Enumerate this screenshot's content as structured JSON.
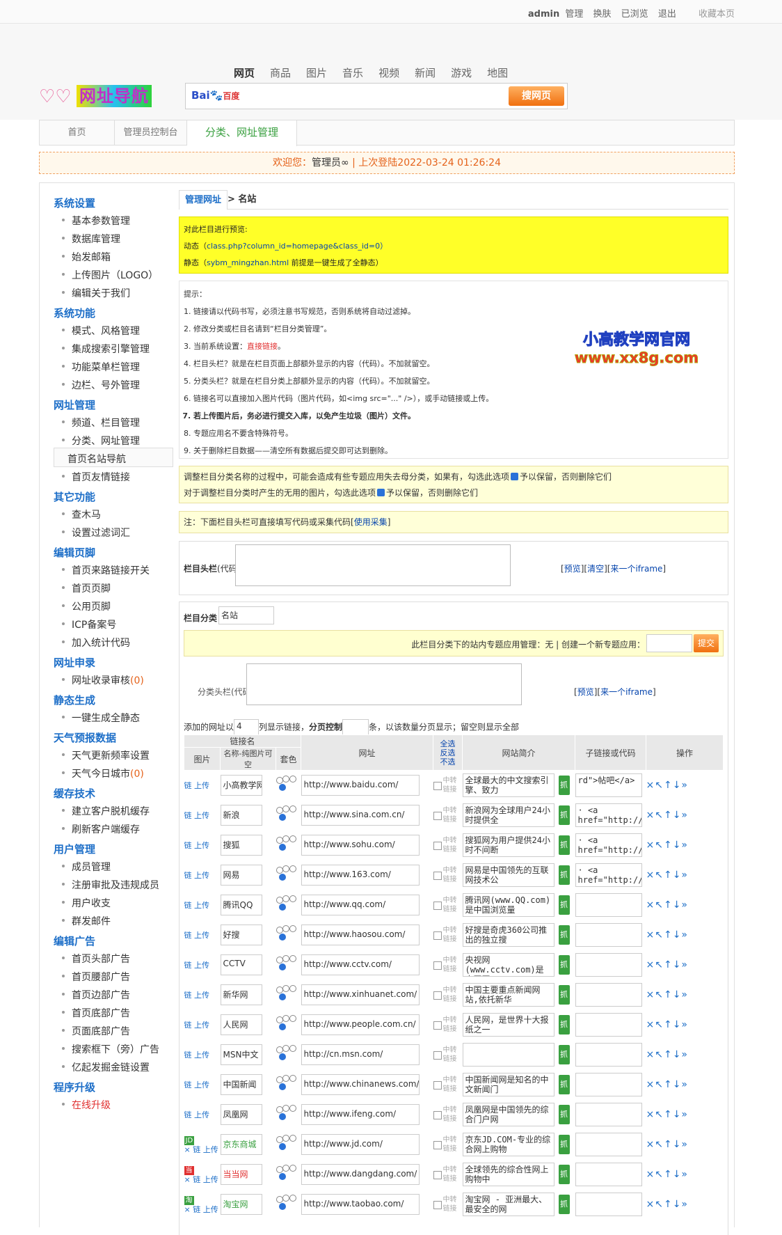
{
  "topbar": {
    "user": "admin",
    "manage": "管理",
    "skin": "换肤",
    "viewed": "已浏览",
    "logout": "退出",
    "bookmark": "收藏本页"
  },
  "logo": {
    "text": "网址导航"
  },
  "search": {
    "tabs": [
      "网页",
      "商品",
      "图片",
      "音乐",
      "视频",
      "新闻",
      "游戏",
      "地图"
    ],
    "engine_a": "Bai",
    "engine_b": "百度",
    "button": "搜网页",
    "placeholder": ""
  },
  "crumb": {
    "home": "首页",
    "console": "管理员控制台",
    "current": "分类、网址管理"
  },
  "welcome": {
    "prefix": "欢迎您：",
    "name": "管理员",
    "sep": "|",
    "last_login": "上次登陆2022-03-24 01:26:24"
  },
  "sidebar": [
    {
      "title": "系统设置",
      "items": [
        "基本参数管理",
        "数据库管理",
        "始发邮箱",
        "上传图片（LOGO）",
        "编辑关于我们"
      ]
    },
    {
      "title": "系统功能",
      "items": [
        "模式、风格管理",
        "集成搜索引擎管理",
        "功能菜单栏管理",
        "边栏、号外管理"
      ]
    },
    {
      "title": "网址管理",
      "items": [
        "频道、栏目管理",
        "分类、网址管理",
        "首页名站导航",
        "首页友情链接"
      ]
    },
    {
      "title": "其它功能",
      "items": [
        "查木马",
        "设置过滤词汇"
      ]
    },
    {
      "title": "编辑页脚",
      "items": [
        "首页来路链接开关",
        "首页页脚",
        "公用页脚",
        "ICP备案号",
        "加入统计代码"
      ]
    },
    {
      "title": "网址申录",
      "items": [
        "网址收录审核"
      ],
      "count": "(0)"
    },
    {
      "title": "静态生成",
      "items": [
        "一键生成全静态"
      ]
    },
    {
      "title": "天气预报数据",
      "items": [
        "天气更新频率设置",
        "天气今日城市"
      ],
      "count2": "(0)"
    },
    {
      "title": "缓存技术",
      "items": [
        "建立客户脱机缓存",
        "刷新客户端缓存"
      ]
    },
    {
      "title": "用户管理",
      "items": [
        "成员管理",
        "注册审批及违规成员",
        "用户收支",
        "群发邮件"
      ]
    },
    {
      "title": "编辑广告",
      "items": [
        "首页头部广告",
        "首页腰部广告",
        "首页边部广告",
        "首页底部广告",
        "页面底部广告",
        "搜索框下（旁）广告",
        "亿起发掘金链设置"
      ]
    },
    {
      "title": "程序升级",
      "items": [
        "在线升级"
      ]
    }
  ],
  "content": {
    "tab": "管理网址",
    "crumb": "> 名站",
    "preview": {
      "title": "对此栏目进行预览:",
      "dyn_label": "动态（",
      "dyn_link": "class.php?column_id=homepage&class_id=0）",
      "static_label": "静态（",
      "static_link": "sybm_mingzhan.html",
      "static_tail": " 前提是一键生成了全静态）",
      "dyn_tail": "）"
    },
    "tips_title": "提示：",
    "tips": [
      "链接请以代码书写，必须注意书写规范，否则系统将自动过滤掉。",
      "修改分类或栏目名请到“栏目分类管理”。",
      "当前系统设置：",
      "栏目头栏？就是在栏目页面上部额外显示的内容（代码）。不加就留空。",
      "分类头栏？就是在栏目分类上部额外显示的内容（代码）。不加就留空。",
      "链接名可以直接加入图片代码（图片代码，如<img src=\"...\" />），或手动链接或上传。",
      "若上传图片后，务必进行提交入库，以免产生垃圾（图片）文件。",
      "专题应用名不要含特殊符号。",
      "关于删除栏目数据——清空所有数据后提交即可达到删除。"
    ],
    "tip3_red": "直接链接",
    "stamp": {
      "l1": "小高教学网官网",
      "l2": "www.xx8g.com"
    },
    "note1a": "调整栏目分类名称的过程中，可能会造成有些专题应用失去母分类，如果有，勾选此选项",
    "note1a_tail": "予以保留，否则删除它们",
    "note1b": "对于调整栏目分类时产生的无用的图片，勾选此选项",
    "note1b_tail": "予以保留，否则删除它们",
    "note2": "注：下面栏目头栏可直接填写代码或采集代码[",
    "note2_link": "使用采集",
    "note2_tail": "]",
    "headbar": {
      "label": "栏目头栏",
      "label2": "(代码)",
      "links": [
        "[",
        "预览",
        "][",
        "清空",
        "][",
        "来一个iframe",
        "]"
      ]
    },
    "cat": {
      "label": "栏目分类",
      "value": "名站",
      "mgr_text": "此栏目分类下的站内专题应用管理：无 | 创建一个新专题应用：",
      "submit": "提交",
      "sub_label": "分类头栏(代码)",
      "sub_links": [
        "[",
        "预览",
        "][",
        "来一个iframe",
        "]"
      ]
    },
    "ctrl": {
      "a": "添加的网址以",
      "value": "4",
      "b": "列显示链接，",
      "c": "分页控制",
      "d": "条，以该数量分页显示；留空则显示全部"
    },
    "table": {
      "h_name": "链接名",
      "h_pic": "图片",
      "h_name2": "名称-纯图片可空",
      "h_style": "套色",
      "h_url": "网址",
      "h_all": "全选",
      "h_inv": "反选",
      "h_none": "不选",
      "h_desc": "网站简介",
      "h_sub": "子链接或代码",
      "h_op": "操作"
    },
    "rows": [
      {
        "name": "小高教学网",
        "url": "http://www.baidu.com/",
        "desc": "全球最大的中文搜索引擎、致力",
        "sub": "rd\">帖吧</a>"
      },
      {
        "name": "新浪",
        "url": "http://www.sina.com.cn/",
        "desc": "新浪网为全球用户24小时提供全",
        "sub": "· <a href=\"http://"
      },
      {
        "name": "搜狐",
        "url": "http://www.sohu.com/",
        "desc": "搜狐网为用户提供24小时不间断",
        "sub": "· <a href=\"http://"
      },
      {
        "name": "网易",
        "url": "http://www.163.com/",
        "desc": "网易是中国领先的互联网技术公",
        "sub": "· <a href=\"http://"
      },
      {
        "name": "腾讯QQ",
        "url": "http://www.qq.com/",
        "desc": "腾讯网(www.QQ.com)是中国浏览量",
        "sub": ""
      },
      {
        "name": "好搜",
        "url": "http://www.haosou.com/",
        "desc": "好搜是奇虎360公司推出的独立搜",
        "sub": ""
      },
      {
        "name": "CCTV",
        "url": "http://www.cctv.com/",
        "desc": "央视网(www.cctv.com)是中国网",
        "sub": ""
      },
      {
        "name": "新华网",
        "url": "http://www.xinhuanet.com/",
        "desc": "中国主要重点新闻网站,依托新华",
        "sub": ""
      },
      {
        "name": "人民网",
        "url": "http://www.people.com.cn/",
        "desc": "人民网，是世界十大报纸之一",
        "sub": ""
      },
      {
        "name": "MSN中文",
        "url": "http://cn.msn.com/",
        "desc": "",
        "sub": ""
      },
      {
        "name": "中国新闻",
        "url": "http://www.chinanews.com/",
        "desc": "中国新闻网是知名的中文新闻门",
        "sub": ""
      },
      {
        "name": "凤凰网",
        "url": "http://www.ifeng.com/",
        "desc": "凤凰网是中国领先的综合门户网",
        "sub": ""
      },
      {
        "name": "京东商城",
        "url": "http://www.jd.com/",
        "desc": "京东JD.COM-专业的综合网上购物",
        "sub": "",
        "img": "JD",
        "color": "#3aa040"
      },
      {
        "name": "当当网",
        "url": "http://www.dangdang.com/",
        "desc": "全球领先的综合性网上购物中",
        "sub": "",
        "img": "当",
        "color": "#e03030"
      },
      {
        "name": "淘宝网",
        "url": "http://www.taobao.com/",
        "desc": "淘宝网 - 亚洲最大、最安全的网",
        "sub": "",
        "img": "淘",
        "color": "#3aa040"
      }
    ],
    "row_link": "链",
    "row_upload": "上传",
    "row_x": "×",
    "row_zz1": "中转",
    "row_zz2": "链接",
    "row_zhua": "抓",
    "row_ops": "×↖↑↓»"
  }
}
